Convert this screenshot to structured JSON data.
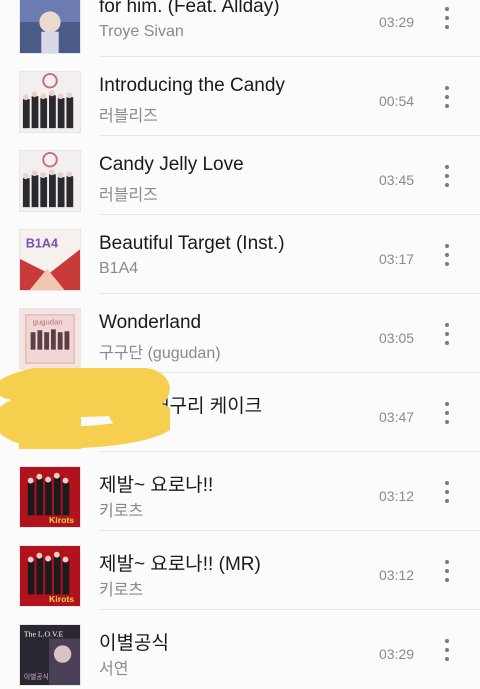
{
  "tracks": [
    {
      "title": "for him. (Feat. Allday)",
      "artist": "Troye Sivan",
      "duration": "03:29",
      "art": "art-troye"
    },
    {
      "title": "Introducing the Candy",
      "artist": "러블리즈",
      "duration": "00:54",
      "art": "art-lovelyz"
    },
    {
      "title": "Candy Jelly Love",
      "artist": "러블리즈",
      "duration": "03:45",
      "art": "art-lovelyz"
    },
    {
      "title": "Beautiful Target (Inst.)",
      "artist": "B1A4",
      "duration": "03:17",
      "art": "art-b1a4"
    },
    {
      "title": "Wonderland",
      "artist": "구구단 (gugudan)",
      "duration": "03:05",
      "art": "art-gugudan"
    },
    {
      "title": "개구리 케이크",
      "artist": "",
      "duration": "03:47",
      "art": "art-redacted"
    },
    {
      "title": "제발~ 요로나!!",
      "artist": "키로츠",
      "duration": "03:12",
      "art": "art-kirots"
    },
    {
      "title": "제발~ 요로나!! (MR)",
      "artist": "키로츠",
      "duration": "03:12",
      "art": "art-kirots"
    },
    {
      "title": "이별공식",
      "artist": "서연",
      "duration": "03:29",
      "art": "art-seoyeon"
    }
  ],
  "art_text": {
    "b1a4": "B1A4",
    "gugudan": "gugudan",
    "kirots": "Kirots",
    "seoyeon_line1": "The L.O.V.E",
    "seoyeon_line2": "이별공식"
  },
  "colors": {
    "title": "#1a1a1a",
    "secondary": "#8a8a8a",
    "scribble": "#f7cf4f"
  }
}
